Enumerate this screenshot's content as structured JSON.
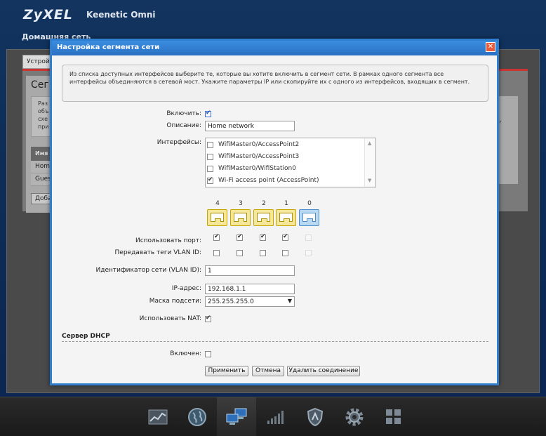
{
  "background": {
    "brand": "ZyXEL",
    "model": "Keenetic Omni",
    "subtitle": "Домашняя сеть",
    "tab": "Устрой",
    "section_title": "Сегм",
    "info_lines": [
      "Раз",
      "объ",
      "схе",
      "при"
    ],
    "table_header": "Имя",
    "rows": [
      "Home",
      "Gues"
    ],
    "add_button": "Доба",
    "chevron": "›"
  },
  "dialog": {
    "title": "Настройка сегмента сети",
    "close_glyph": "✕",
    "info": "Из списка доступных интерфейсов выберите те, которые вы хотите включить в сегмент сети. В рамках одного сегмента все интерфейсы объединяются в сетевой мост. Укажите параметры IP или скопируйте их с одного из интерфейсов, входящих в сегмент.",
    "enable_label": "Включить:",
    "enable_checked": true,
    "description_label": "Описание:",
    "description_value": "Home network",
    "interfaces_label": "Интерфейсы:",
    "interfaces": [
      {
        "name": "WifiMaster0/AccessPoint2",
        "checked": false
      },
      {
        "name": "WifiMaster0/AccessPoint3",
        "checked": false
      },
      {
        "name": "WifiMaster0/WifiStation0",
        "checked": false
      },
      {
        "name": "Wi-Fi access point (AccessPoint)",
        "checked": true
      }
    ],
    "ports": [
      "4",
      "3",
      "2",
      "1",
      "0"
    ],
    "use_port_label": "Использовать порт:",
    "use_port": [
      true,
      true,
      true,
      true,
      false
    ],
    "vlan_tags_label": "Передавать теги VLAN ID:",
    "vlan_tags": [
      false,
      false,
      false,
      false,
      false
    ],
    "vlan_id_label": "Идентификатор сети (VLAN ID):",
    "vlan_id_value": "1",
    "ip_label": "IP-адрес:",
    "ip_value": "192.168.1.1",
    "mask_label": "Маска подсети:",
    "mask_value": "255.255.255.0",
    "mask_arrow": "▼",
    "nat_label": "Использовать NAT:",
    "nat_checked": true,
    "dhcp_title": "Сервер DHCP",
    "dhcp_enabled_label": "Включен:",
    "dhcp_enabled": false,
    "buttons": {
      "apply": "Применить",
      "cancel": "Отмена",
      "delete": "Удалить соединение"
    }
  },
  "dock": {
    "items": [
      "chart-icon",
      "globe-icon",
      "network-icon",
      "signal-icon",
      "shield-icon",
      "gear-icon",
      "apps-icon"
    ],
    "active": "network-icon"
  },
  "colors": {
    "dialog_border": "#2f7fd1",
    "port_yellow": "#f5e79a",
    "port_blue": "#b9d8f1",
    "background": "#0d2d57"
  }
}
